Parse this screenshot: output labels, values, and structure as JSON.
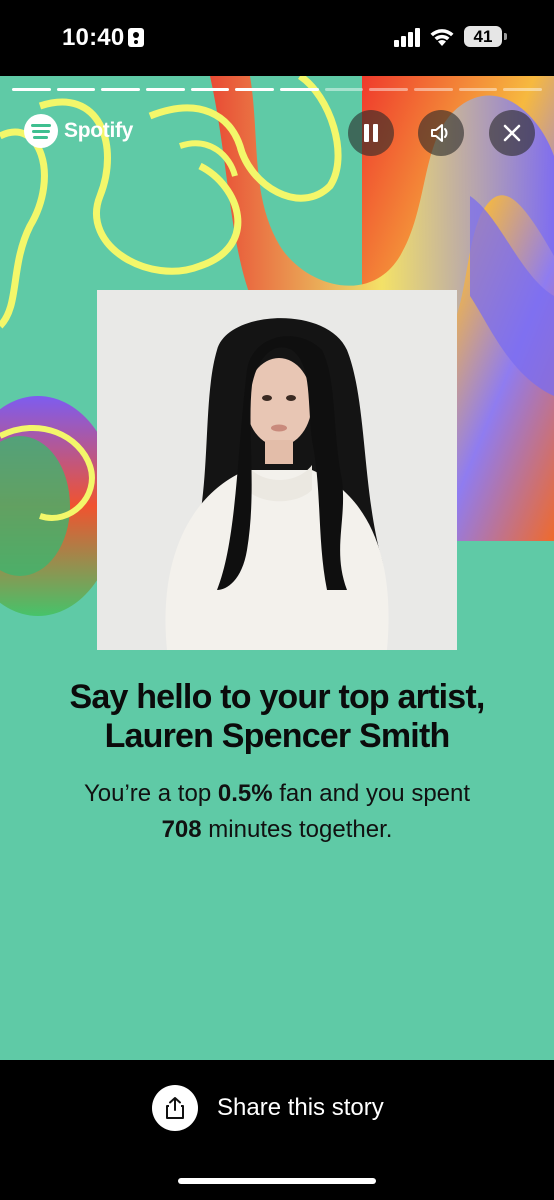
{
  "status_bar": {
    "time": "10:40",
    "battery": "41"
  },
  "story": {
    "progress": {
      "total_segments": 12,
      "completed_segments": 7
    },
    "brand": "Spotify",
    "controls": {
      "pause_icon": "pause-icon",
      "sound_icon": "speaker-icon",
      "close_icon": "close-icon"
    },
    "headline_line1": "Say hello to your top artist,",
    "headline_line2": "Lauren Spencer Smith",
    "fan_prefix": "You’re a top ",
    "fan_percent": "0.5%",
    "fan_suffix": " fan and you spent",
    "minutes_value": "708",
    "minutes_suffix": " minutes together.",
    "colors": {
      "background": "#5fcaa6",
      "accent_yellow": "#f3f76a",
      "accent_red": "#ef3a2c",
      "accent_purple": "#8f7cf0"
    }
  },
  "bottom_bar": {
    "share_label": "Share this story",
    "share_icon": "share-icon"
  }
}
